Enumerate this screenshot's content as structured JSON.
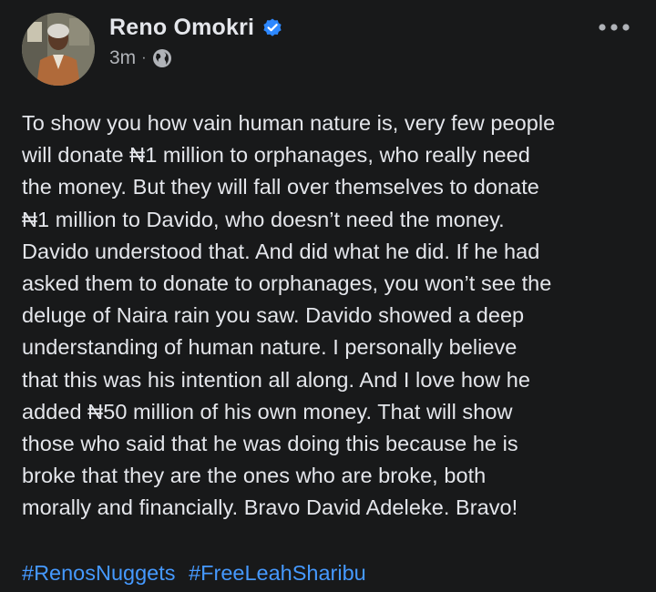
{
  "post": {
    "author": {
      "name": "Reno Omokri",
      "verified": true,
      "avatar_icon": "profile-photo"
    },
    "timestamp": "3m",
    "separator": "·",
    "audience_icon": "globe-icon",
    "more_icon": "more-options-icon",
    "body": "To show you how vain human nature is, very few people\nwill donate ₦1 million to orphanages, who really need\nthe money. But they will fall over themselves to donate\n₦1 million to Davido, who doesn’t need the money.\nDavido understood that. And did what he did. If he had\nasked them to donate to orphanages, you won’t see the\ndeluge of Naira rain you saw. Davido showed a deep\nunderstanding of human nature. I personally believe\nthat this was his intention all along. And I love how he\nadded ₦50 million of his own money. That will show\nthose who said that he was doing this because he is\nbroke that they are the ones who are broke, both\nmorally and financially. Bravo David Adeleke. Bravo!",
    "hashtags": [
      "#RenosNuggets",
      "#FreeLeahSharibu"
    ]
  },
  "colors": {
    "background": "#18191a",
    "text_primary": "#e4e6eb",
    "text_secondary": "#b0b3b8",
    "link": "#4599ff",
    "verified_badge": "#2d88ff"
  }
}
